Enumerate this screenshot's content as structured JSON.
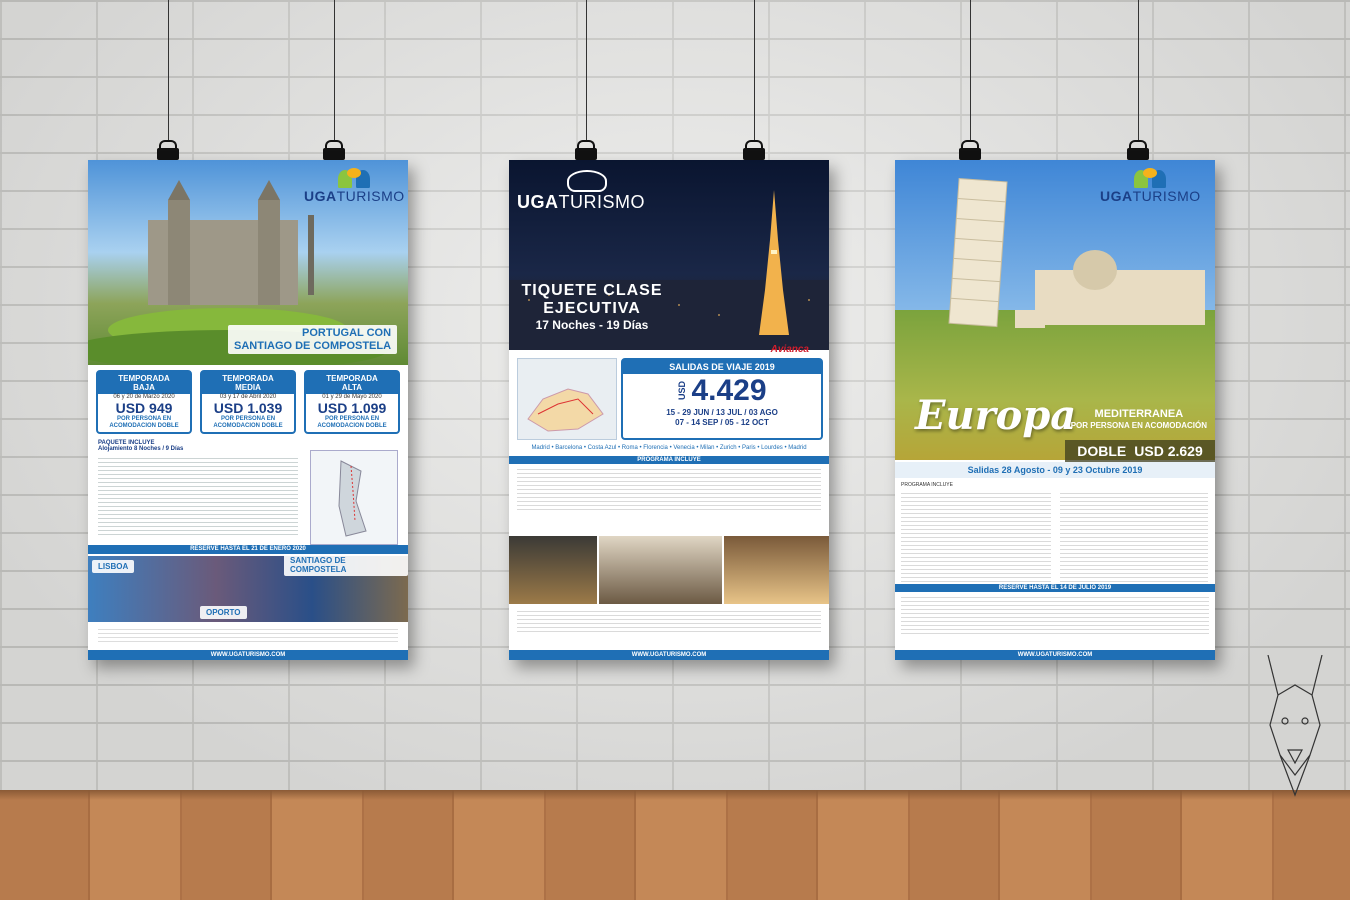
{
  "brand": {
    "bold": "UGA",
    "light": "TURISMO",
    "url": "WWW.UGATURISMO.COM"
  },
  "poster1": {
    "title_line1": "PORTUGAL  CON",
    "title_line2": "SANTIAGO DE COMPOSTELA",
    "seasons": [
      {
        "label_top": "TEMPORADA",
        "label": "BAJA",
        "dates": "06 y 20 de Marzo 2020",
        "price": "USD 949",
        "note1": "POR PERSONA EN",
        "note2": "ACOMODACION DOBLE"
      },
      {
        "label_top": "TEMPORADA",
        "label": "MEDIA",
        "dates": "03 y 17 de Abril 2020",
        "price": "USD 1.039",
        "note1": "POR PERSONA EN",
        "note2": "ACOMODACION DOBLE"
      },
      {
        "label_top": "TEMPORADA",
        "label": "ALTA",
        "dates": "01 y 29 de Mayo 2020",
        "price": "USD 1.099",
        "note1": "POR PERSONA EN",
        "note2": "ACOMODACION DOBLE"
      }
    ],
    "package_header": "PAQUETE INCLUYE",
    "package_item": "Alojamiento 8 Noches / 9 Días",
    "reserve": "RESERVE HASTA EL 21 DE ENERO 2020",
    "places": {
      "a": "LISBOA",
      "b": "OPORTO",
      "c": "SANTIAGO DE COMPOSTELA"
    }
  },
  "poster2": {
    "title_line1": "TIQUETE CLASE",
    "title_line2": "EJECUTIVA",
    "title_line3": "17 Noches - 19 Días",
    "airline": "Avianca",
    "sal_header": "SALIDAS DE VIAJE 2019",
    "currency": "USD",
    "price": "4.429",
    "dates1": "15 - 29 JUN / 13 JUL / 03 AGO",
    "dates2": "07 - 14 SEP / 05 - 12 OCT",
    "cities": "Madrid • Barcelona • Costa Azul • Roma • Florencia • Venecia • Milan • Zurich • Paris • Lourdes • Madrid",
    "programa": "PROGRAMA INCLUYE"
  },
  "poster3": {
    "title": "Europa",
    "sub1": "MEDITERRANEA",
    "sub2": "POR PERSONA  EN ACOMODACIÓN",
    "doble": "DOBLE",
    "price": "USD 2.629",
    "salidas": "Salidas  28 Agosto - 09 y 23  Octubre 2019",
    "programa": "PROGRAMA INCLUYE",
    "reserve": "RESERVE HASTA EL 14 DE JULIO 2019"
  },
  "colors": {
    "accent": "#1f6fb5",
    "navy": "#1b3f87"
  }
}
